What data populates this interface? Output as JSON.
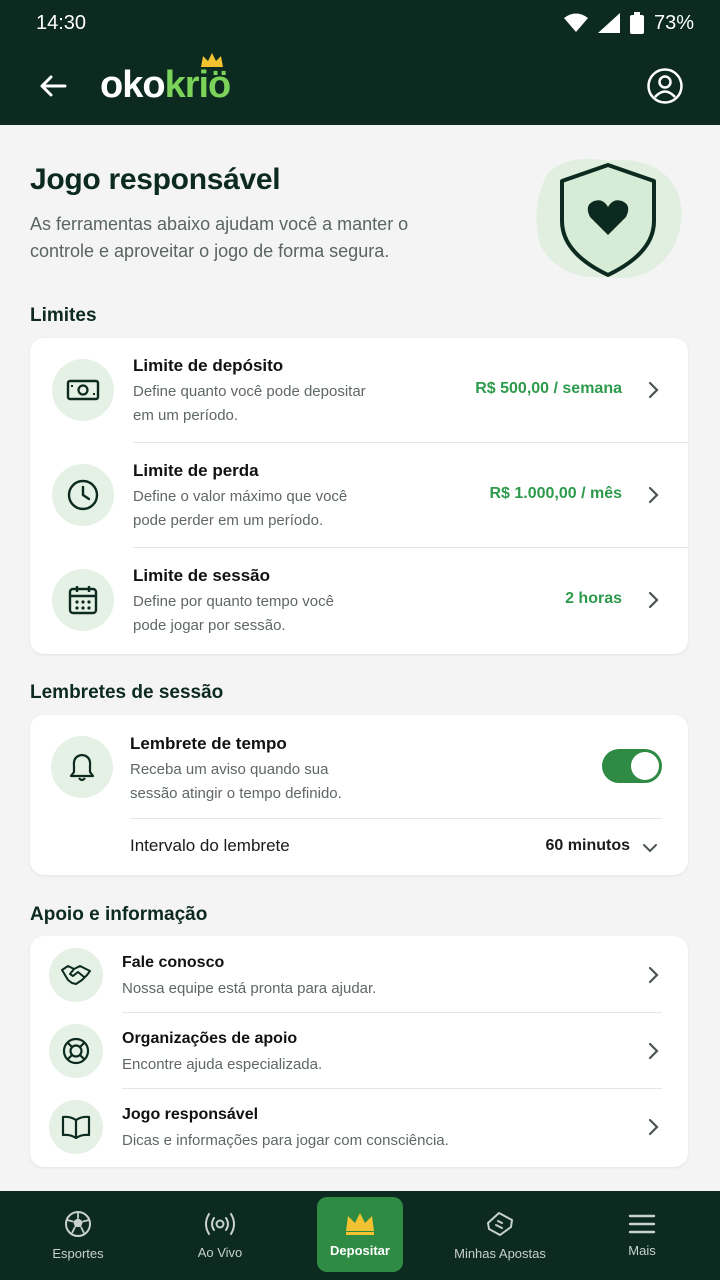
{
  "status_bar": {
    "time": "14:30",
    "battery": "73%"
  },
  "app_bar": {
    "logo_part1": "oko",
    "logo_part2": "kri",
    "logo_part3": "ö"
  },
  "hero": {
    "title": "Jogo responsável",
    "description_line1": "As ferramentas abaixo ajudam você a manter o",
    "description_line2": "controle e aproveitar o jogo de forma segura."
  },
  "limits": {
    "section_title": "Limites",
    "items": [
      {
        "title": "Limite de depósito",
        "desc_line1": "Define quanto você pode depositar",
        "desc_line2": "em um período.",
        "value": "R$ 500,00 / semana",
        "icon": "money-icon"
      },
      {
        "title": "Limite de perda",
        "desc_line1": "Define o valor máximo que você",
        "desc_line2": "pode perder em um período.",
        "value": "R$ 1.000,00 / mês",
        "icon": "clock-icon"
      },
      {
        "title": "Limite de sessão",
        "desc_line1": "Define por quanto tempo você",
        "desc_line2": "pode jogar por sessão.",
        "value": "2 horas",
        "icon": "calendar-icon"
      }
    ]
  },
  "reminders": {
    "section_title": "Lembretes de sessão",
    "reminder_title": "Lembrete de tempo",
    "reminder_desc_line1": "Receba um aviso quando sua",
    "reminder_desc_line2": "sessão atingir o tempo definido.",
    "toggle_on": true,
    "interval_label": "Intervalo do lembrete",
    "interval_value": "60 minutos"
  },
  "support": {
    "section_title": "Apoio e informação",
    "items": [
      {
        "title": "Fale conosco",
        "desc": "Nossa equipe está pronta para ajudar.",
        "icon": "handshake-icon"
      },
      {
        "title": "Organizações de apoio",
        "desc": "Encontre ajuda especializada.",
        "icon": "lifebuoy-icon"
      },
      {
        "title": "Jogo responsável",
        "desc": "Dicas e informações para jogar com consciência.",
        "icon": "book-icon"
      }
    ]
  },
  "bottom_nav": {
    "items": [
      {
        "label": "Esportes",
        "icon": "soccer-ball-icon"
      },
      {
        "label": "Ao Vivo",
        "icon": "live-broadcast-icon"
      },
      {
        "label": "Depositar",
        "icon": "crown-icon",
        "active": true
      },
      {
        "label": "Minhas Apostas",
        "icon": "ticket-icon"
      },
      {
        "label": "Mais",
        "icon": "menu-icon"
      }
    ]
  },
  "colors": {
    "brand_dark": "#0c2a1f",
    "accent_green": "#2d9a4c",
    "logo_green": "#7bd35a",
    "crown_gold": "#f2c230"
  }
}
